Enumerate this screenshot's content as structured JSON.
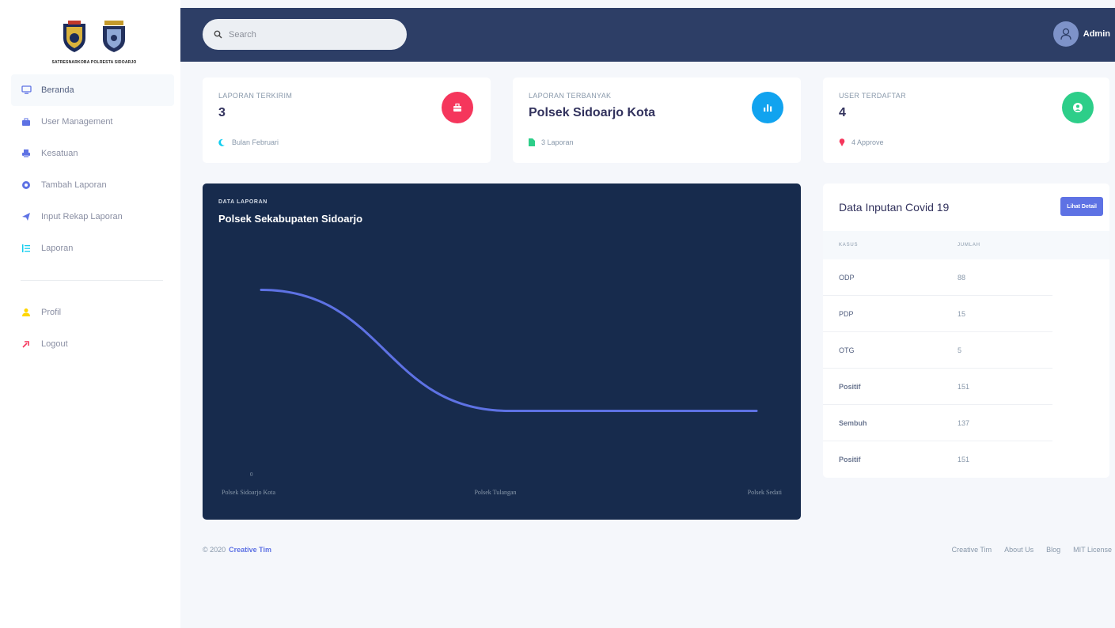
{
  "sidebar": {
    "logo_text": "SATRESNARKOBA POLRESTA SIDOARJO",
    "items": [
      {
        "label": "Beranda",
        "icon": "monitor-icon",
        "color": "#5e72e4",
        "active": true
      },
      {
        "label": "User Management",
        "icon": "briefcase-icon",
        "color": "#5e72e4"
      },
      {
        "label": "Kesatuan",
        "icon": "printer-icon",
        "color": "#5e72e4"
      },
      {
        "label": "Tambah Laporan",
        "icon": "circle-plus-icon",
        "color": "#5e72e4"
      },
      {
        "label": "Input Rekap Laporan",
        "icon": "send-icon",
        "color": "#5e72e4"
      },
      {
        "label": "Laporan",
        "icon": "list-icon",
        "color": "#11cdef"
      }
    ],
    "bottom_items": [
      {
        "label": "Profil",
        "icon": "user-icon",
        "color": "#ffd600"
      },
      {
        "label": "Logout",
        "icon": "logout-icon",
        "color": "#f5365c"
      }
    ]
  },
  "topbar": {
    "search_placeholder": "Search",
    "user_name": "Admin"
  },
  "stats": [
    {
      "title": "Laporan Terkirim",
      "value": "3",
      "foot": "Bulan Februari",
      "icon": "briefcase-icon",
      "color": "#f5365c",
      "foot_icon": "moon-icon",
      "foot_color": "#11cdef"
    },
    {
      "title": "Laporan Terbanyak",
      "value": "Polsek Sidoarjo Kota",
      "foot": "3 Laporan",
      "icon": "bar-chart-icon",
      "color": "#11a3ef",
      "foot_icon": "file-icon",
      "foot_color": "#2dce89"
    },
    {
      "title": "User Terdaftar",
      "value": "4",
      "foot": "4 Approve",
      "icon": "user-circle-icon",
      "color": "#2dce89",
      "foot_icon": "pin-icon",
      "foot_color": "#f5365c"
    }
  ],
  "chart": {
    "overline": "Data Laporan",
    "title": "Polsek Sekabupaten Sidoarjo"
  },
  "chart_data": {
    "type": "line",
    "categories": [
      "Polsek Sidoarjo Kota",
      "Polsek Tulangan",
      "Polsek Sedati"
    ],
    "values": [
      3,
      1,
      1
    ],
    "y_tick_labels": [
      "0"
    ],
    "ylim": [
      0,
      4
    ],
    "line_color": "#5e72e4",
    "grid": false
  },
  "covid": {
    "title": "Data Inputan Covid 19",
    "button": "Lihat Detail",
    "columns": [
      "Kasus",
      "Jumlah"
    ],
    "rows": [
      {
        "kasus": "ODP",
        "jumlah": "88",
        "bold": false
      },
      {
        "kasus": "PDP",
        "jumlah": "15",
        "bold": false
      },
      {
        "kasus": "OTG",
        "jumlah": "5",
        "bold": false
      },
      {
        "kasus": "Positif",
        "jumlah": "151",
        "bold": true
      },
      {
        "kasus": "Sembuh",
        "jumlah": "137",
        "bold": true
      },
      {
        "kasus": "Positif",
        "jumlah": "151",
        "bold": true
      }
    ]
  },
  "footer": {
    "copyright": "© 2020",
    "brand": "Creative Tim",
    "links": [
      "Creative Tim",
      "About Us",
      "Blog",
      "MIT License"
    ]
  }
}
